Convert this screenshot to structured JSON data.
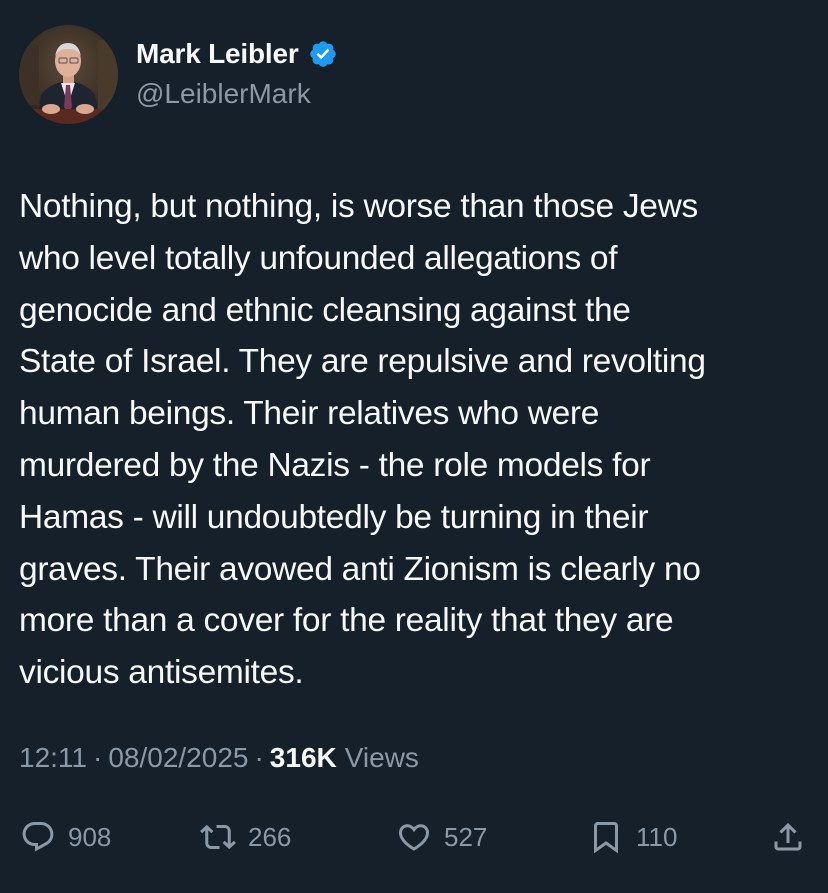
{
  "author": {
    "display_name": "Mark Leibler",
    "handle": "@LeiblerMark",
    "verified": true,
    "verified_color": "#1d9bf0"
  },
  "tweet": {
    "text": "Nothing, but nothing, is worse than those Jews\nwho level  totally unfounded allegations of\ngenocide and ethnic cleansing against the\nState of Israel. They are repulsive and revolting\nhuman beings. Their  relatives who were\nmurdered by the Nazis - the role models for\nHamas - will undoubtedly be turning in their\ngraves. Their avowed anti Zionism is clearly no\nmore than a cover for the reality that they are\nvicious antisemites."
  },
  "meta": {
    "time": "12:11",
    "separator": "·",
    "date": "08/02/2025",
    "views_count": "316K",
    "views_label": "Views"
  },
  "actions": {
    "replies": "908",
    "retweets": "266",
    "likes": "527",
    "bookmarks": "110",
    "icons": {
      "reply": "reply-icon",
      "retweet": "retweet-icon",
      "like": "heart-icon",
      "bookmark": "bookmark-icon",
      "share": "share-icon"
    }
  },
  "colors": {
    "background": "#15202b",
    "text_primary": "#f7f9f9",
    "text_secondary": "#8b98a5"
  }
}
